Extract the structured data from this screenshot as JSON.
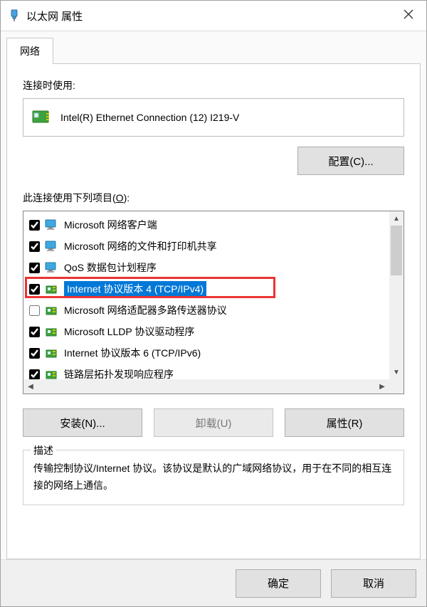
{
  "window": {
    "title": "以太网 属性"
  },
  "tab": {
    "network": "网络"
  },
  "connect_using_label": "连接时使用:",
  "adapter": {
    "name": "Intel(R) Ethernet Connection (12) I219-V"
  },
  "buttons": {
    "configure": "配置(C)...",
    "install": "安装(N)...",
    "uninstall": "卸载(U)",
    "properties": "属性(R)",
    "ok": "确定",
    "cancel": "取消"
  },
  "items_label_prefix": "此连接使用下列项目(",
  "items_label_u": "O",
  "items_label_suffix": "):",
  "items": [
    {
      "checked": true,
      "icon": "client",
      "label": "Microsoft 网络客户端"
    },
    {
      "checked": true,
      "icon": "client",
      "label": "Microsoft 网络的文件和打印机共享"
    },
    {
      "checked": true,
      "icon": "client",
      "label": "QoS 数据包计划程序"
    },
    {
      "checked": true,
      "icon": "protocol",
      "label": "Internet 协议版本 4 (TCP/IPv4)",
      "selected": true
    },
    {
      "checked": false,
      "icon": "protocol",
      "label": "Microsoft 网络适配器多路传送器协议"
    },
    {
      "checked": true,
      "icon": "protocol",
      "label": "Microsoft LLDP 协议驱动程序"
    },
    {
      "checked": true,
      "icon": "protocol",
      "label": "Internet 协议版本 6 (TCP/IPv6)"
    },
    {
      "checked": true,
      "icon": "protocol",
      "label": "链路层拓扑发现响应程序"
    }
  ],
  "description": {
    "legend": "描述",
    "text": "传输控制协议/Internet 协议。该协议是默认的广域网络协议，用于在不同的相互连接的网络上通信。"
  }
}
